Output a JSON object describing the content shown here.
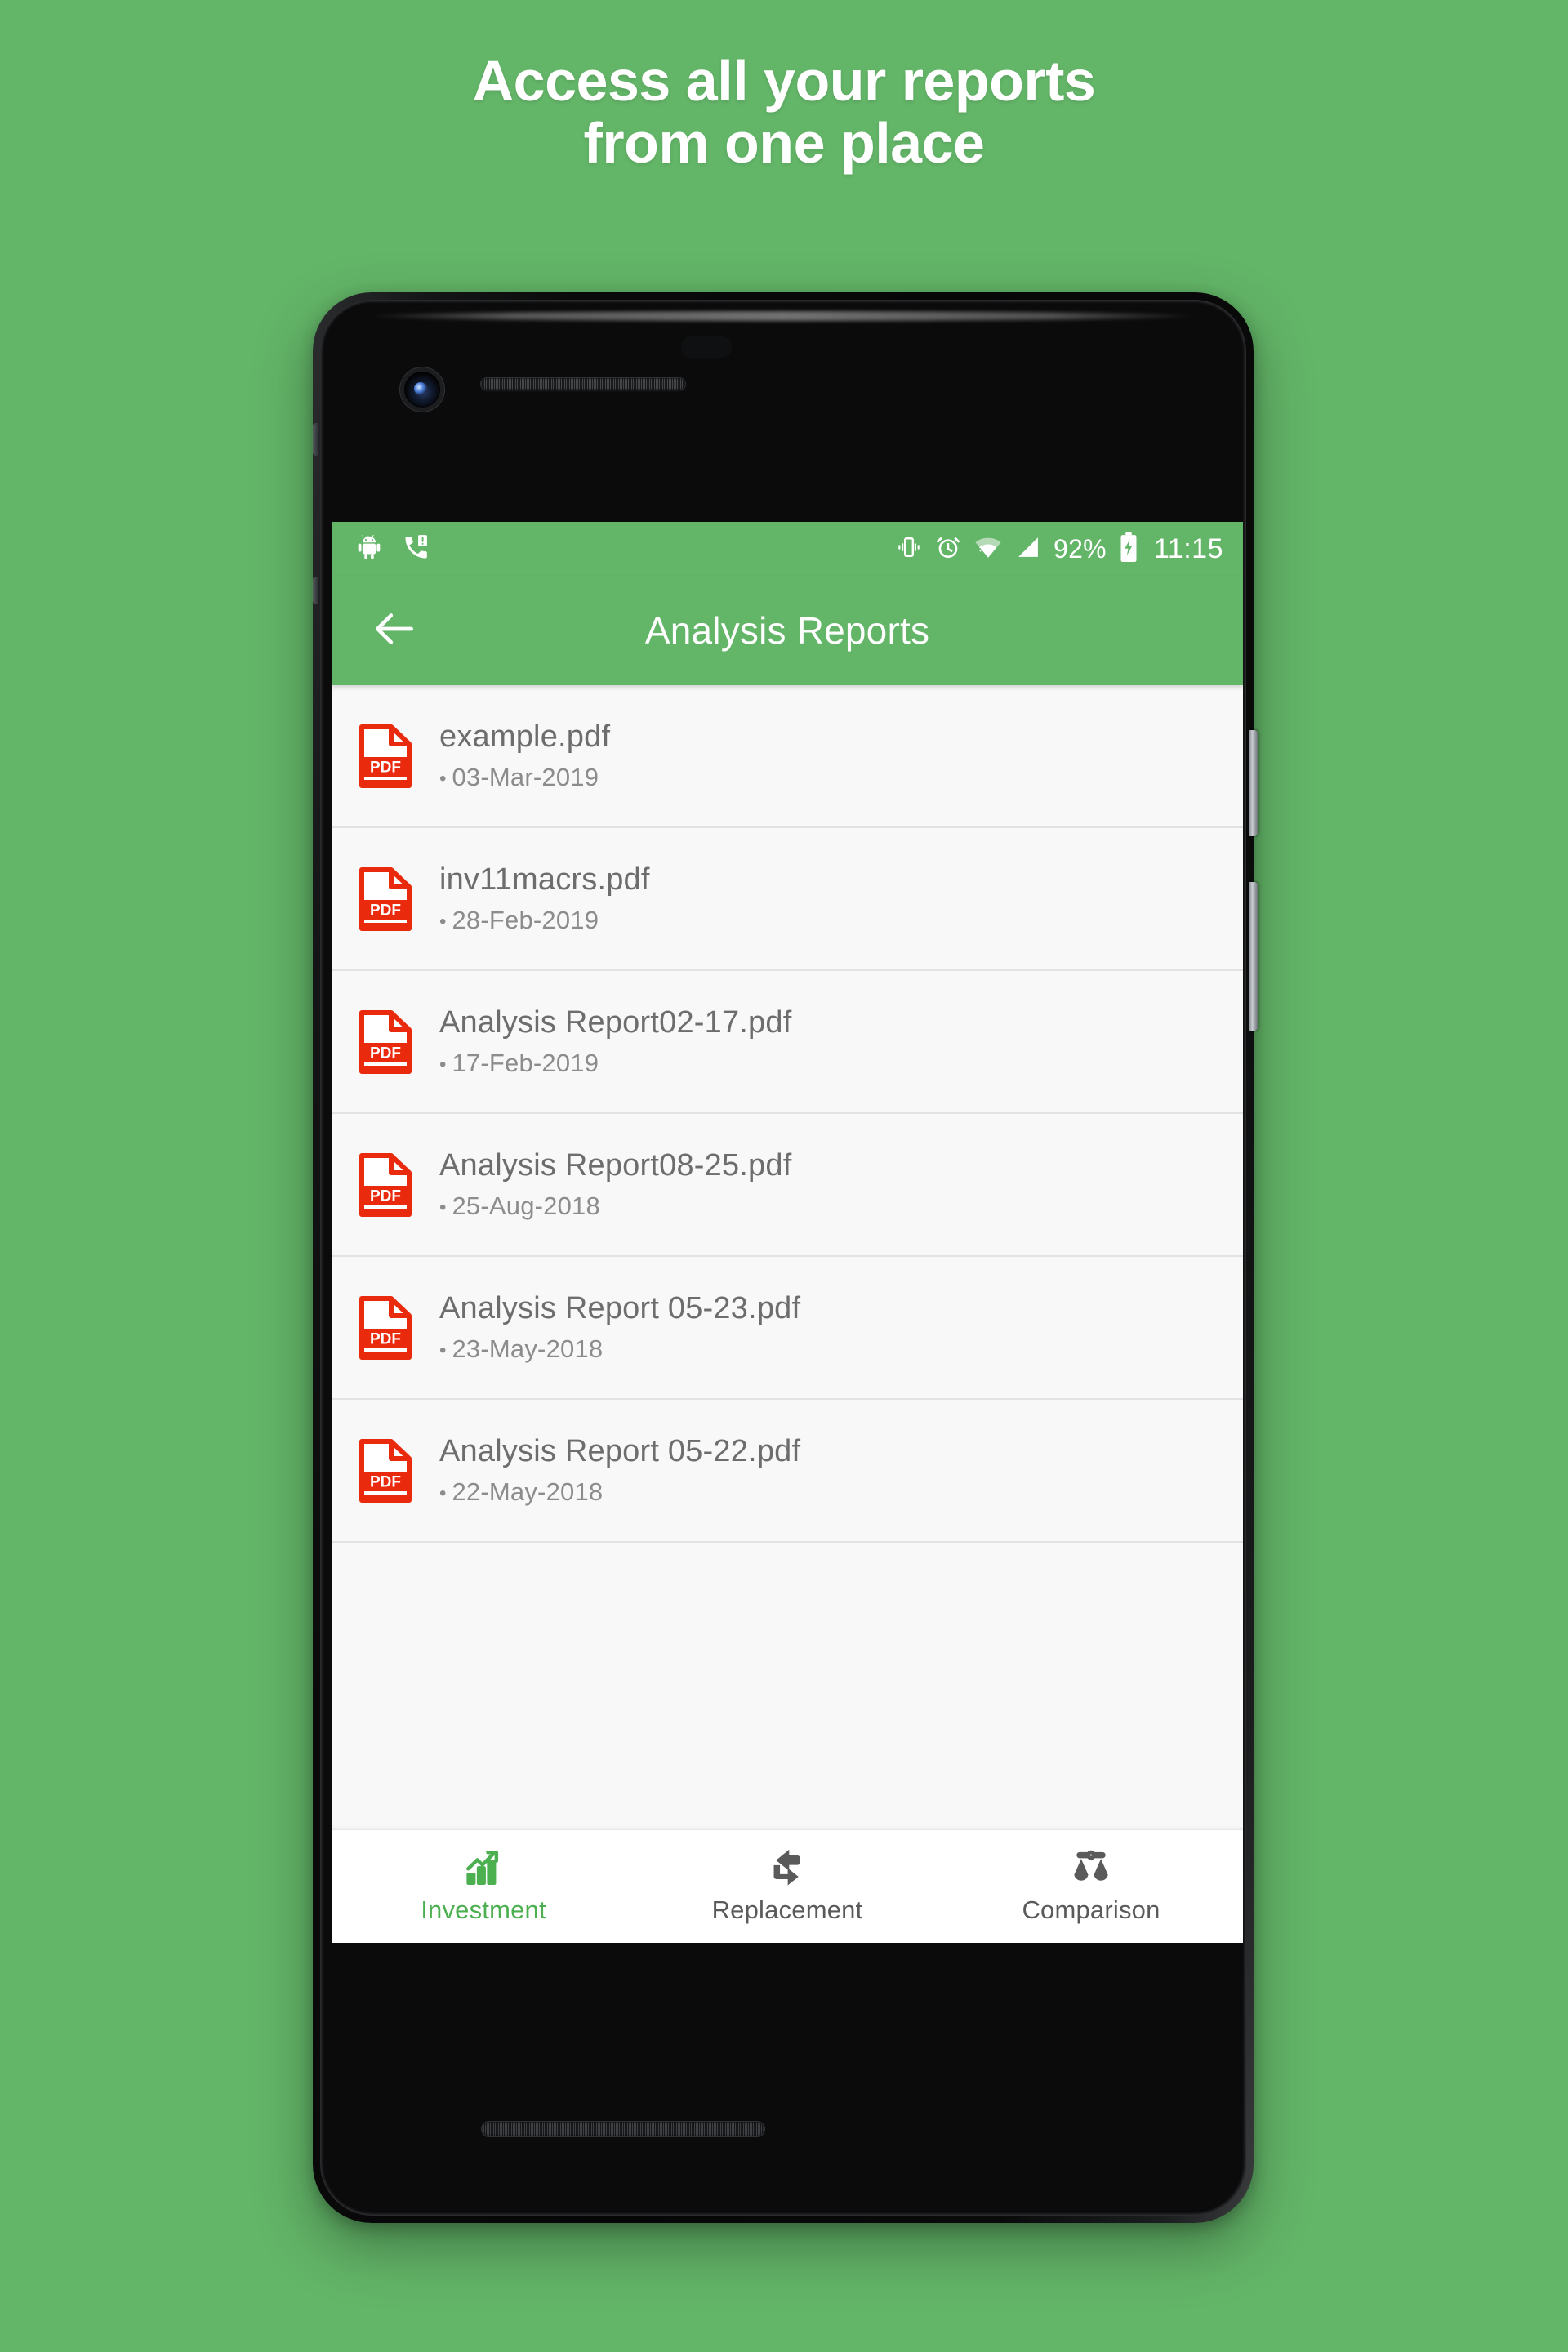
{
  "promo": {
    "headline_line1": "Access all your reports",
    "headline_line2": "from one place",
    "background_color": "#63b568"
  },
  "statusbar": {
    "icons_left": [
      "android-icon",
      "missed-call-icon"
    ],
    "icons_right": [
      "vibrate-icon",
      "alarm-icon",
      "wifi-icon",
      "signal-icon"
    ],
    "battery_percent": "92%",
    "battery_state": "charging-battery-icon",
    "time": "11:15"
  },
  "appbar": {
    "back_icon": "back-arrow-icon",
    "title": "Analysis Reports",
    "color": "#63b568"
  },
  "reports": [
    {
      "icon": "pdf-file-icon",
      "name": "example.pdf",
      "date": "03-Mar-2019"
    },
    {
      "icon": "pdf-file-icon",
      "name": "inv11macrs.pdf",
      "date": "28-Feb-2019"
    },
    {
      "icon": "pdf-file-icon",
      "name": "Analysis Report02-17.pdf",
      "date": "17-Feb-2019"
    },
    {
      "icon": "pdf-file-icon",
      "name": "Analysis Report08-25.pdf",
      "date": "25-Aug-2018"
    },
    {
      "icon": "pdf-file-icon",
      "name": "Analysis Report 05-23.pdf",
      "date": "23-May-2018"
    },
    {
      "icon": "pdf-file-icon",
      "name": "Analysis Report 05-22.pdf",
      "date": "22-May-2018"
    }
  ],
  "bottom_nav": {
    "active_color": "#4caf50",
    "inactive_color": "#5a5a5a",
    "items": [
      {
        "label": "Investment",
        "icon": "bar-chart-growth-icon",
        "active": true
      },
      {
        "label": "Replacement",
        "icon": "swap-arrows-icon",
        "active": false
      },
      {
        "label": "Comparison",
        "icon": "balance-scale-icon",
        "active": false
      }
    ]
  }
}
